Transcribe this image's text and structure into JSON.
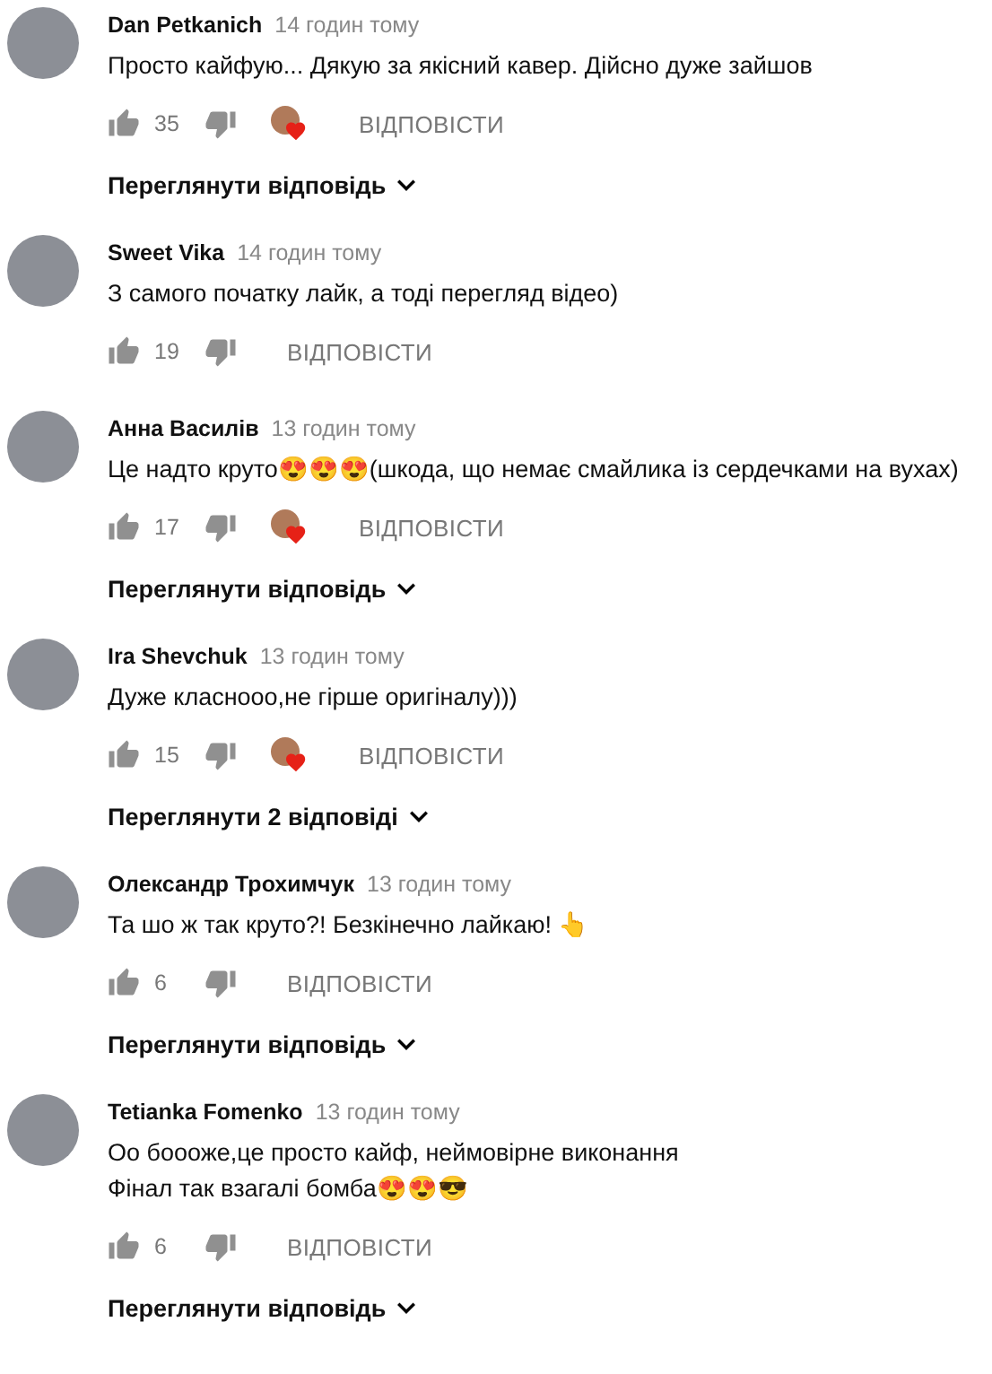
{
  "comments": [
    {
      "author": "Dan Petkanich",
      "time": "14 годин тому",
      "lines": [
        "Просто кайфую... Дякую за якісний кавер. Дійсно дуже зайшов"
      ],
      "likes": "35",
      "creator_heart": true,
      "reply": "ВІДПОВІСТИ",
      "view_replies": "Переглянути відповідь"
    },
    {
      "author": "Sweet Vika",
      "time": "14 годин тому",
      "lines": [
        "З самого початку лайк, а тоді перегляд відео)"
      ],
      "likes": "19",
      "creator_heart": false,
      "reply": "ВІДПОВІСТИ"
    },
    {
      "author": "Анна Василів",
      "time": "13 годин тому",
      "lines": [
        "Це надто круто😍😍😍(шкода, що немає смайлика із сердечками на вухах)"
      ],
      "likes": "17",
      "creator_heart": true,
      "reply": "ВІДПОВІСТИ",
      "view_replies": "Переглянути відповідь"
    },
    {
      "author": "Ira Shevchuk",
      "time": "13 годин тому",
      "lines": [
        "Дуже класнооо,не гірше оригіналу)))"
      ],
      "likes": "15",
      "creator_heart": true,
      "reply": "ВІДПОВІСТИ",
      "view_replies": "Переглянути 2 відповіді"
    },
    {
      "author": "Олександр Трохимчук",
      "time": "13 годин тому",
      "lines": [
        "Та шо ж так круто?! Безкінечно лайкаю! 👆"
      ],
      "likes": "6",
      "creator_heart": false,
      "reply": "ВІДПОВІСТИ",
      "view_replies": "Переглянути відповідь"
    },
    {
      "author": "Tetianka Fomenko",
      "time": "13 годин тому",
      "lines": [
        "Оо боооже,це просто кайф, неймовірне виконання",
        "Фінал так взагалі бомба😍😍😎"
      ],
      "likes": "6",
      "creator_heart": false,
      "reply": "ВІДПОВІСТИ",
      "view_replies": "Переглянути відповідь"
    }
  ]
}
